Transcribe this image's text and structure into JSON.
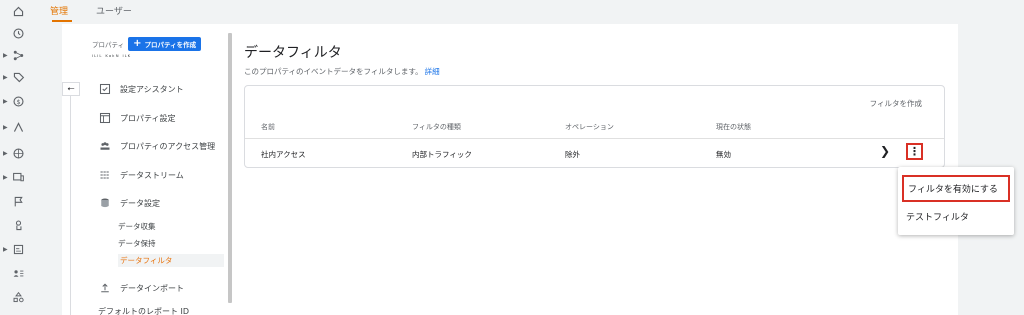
{
  "tabs": [
    {
      "label": "管理"
    },
    {
      "label": "ユーザー"
    }
  ],
  "property": {
    "label": "プロパティ",
    "create_button": "プロパティを作成",
    "name": "ᴵᴸᴵᴸ ᴷᵃᵏᴺ ᴵᴸᴷ"
  },
  "nav": {
    "items": [
      {
        "label": "設定アシスタント",
        "icon": "checkbox-icon"
      },
      {
        "label": "プロパティ設定",
        "icon": "layout-icon"
      },
      {
        "label": "プロパティのアクセス管理",
        "icon": "people-icon"
      },
      {
        "label": "データストリーム",
        "icon": "streams-icon"
      },
      {
        "label": "データ設定",
        "icon": "database-icon"
      },
      {
        "label": "データインポート",
        "icon": "upload-icon"
      }
    ],
    "sub_items": [
      {
        "label": "データ収集"
      },
      {
        "label": "データ保持"
      },
      {
        "label": "データフィルタ"
      }
    ],
    "cut_item": "デフォルトのレポート ID"
  },
  "main": {
    "title": "データフィルタ",
    "description": "このプロパティのイベントデータをフィルタします。",
    "details_link": "詳細",
    "create_filter": "フィルタを作成",
    "columns": [
      "名前",
      "フィルタの種類",
      "オペレーション",
      "現在の状態"
    ],
    "rows": [
      {
        "name": "社内アクセス",
        "type": "内部トラフィック",
        "operation": "除外",
        "status": "無効"
      }
    ]
  },
  "menu": {
    "items": [
      {
        "label": "フィルタを有効にする"
      },
      {
        "label": "テストフィルタ"
      }
    ]
  },
  "colors": {
    "accent_orange": "#e37400",
    "primary_blue": "#1a73e8",
    "highlight_red": "#d93025"
  }
}
